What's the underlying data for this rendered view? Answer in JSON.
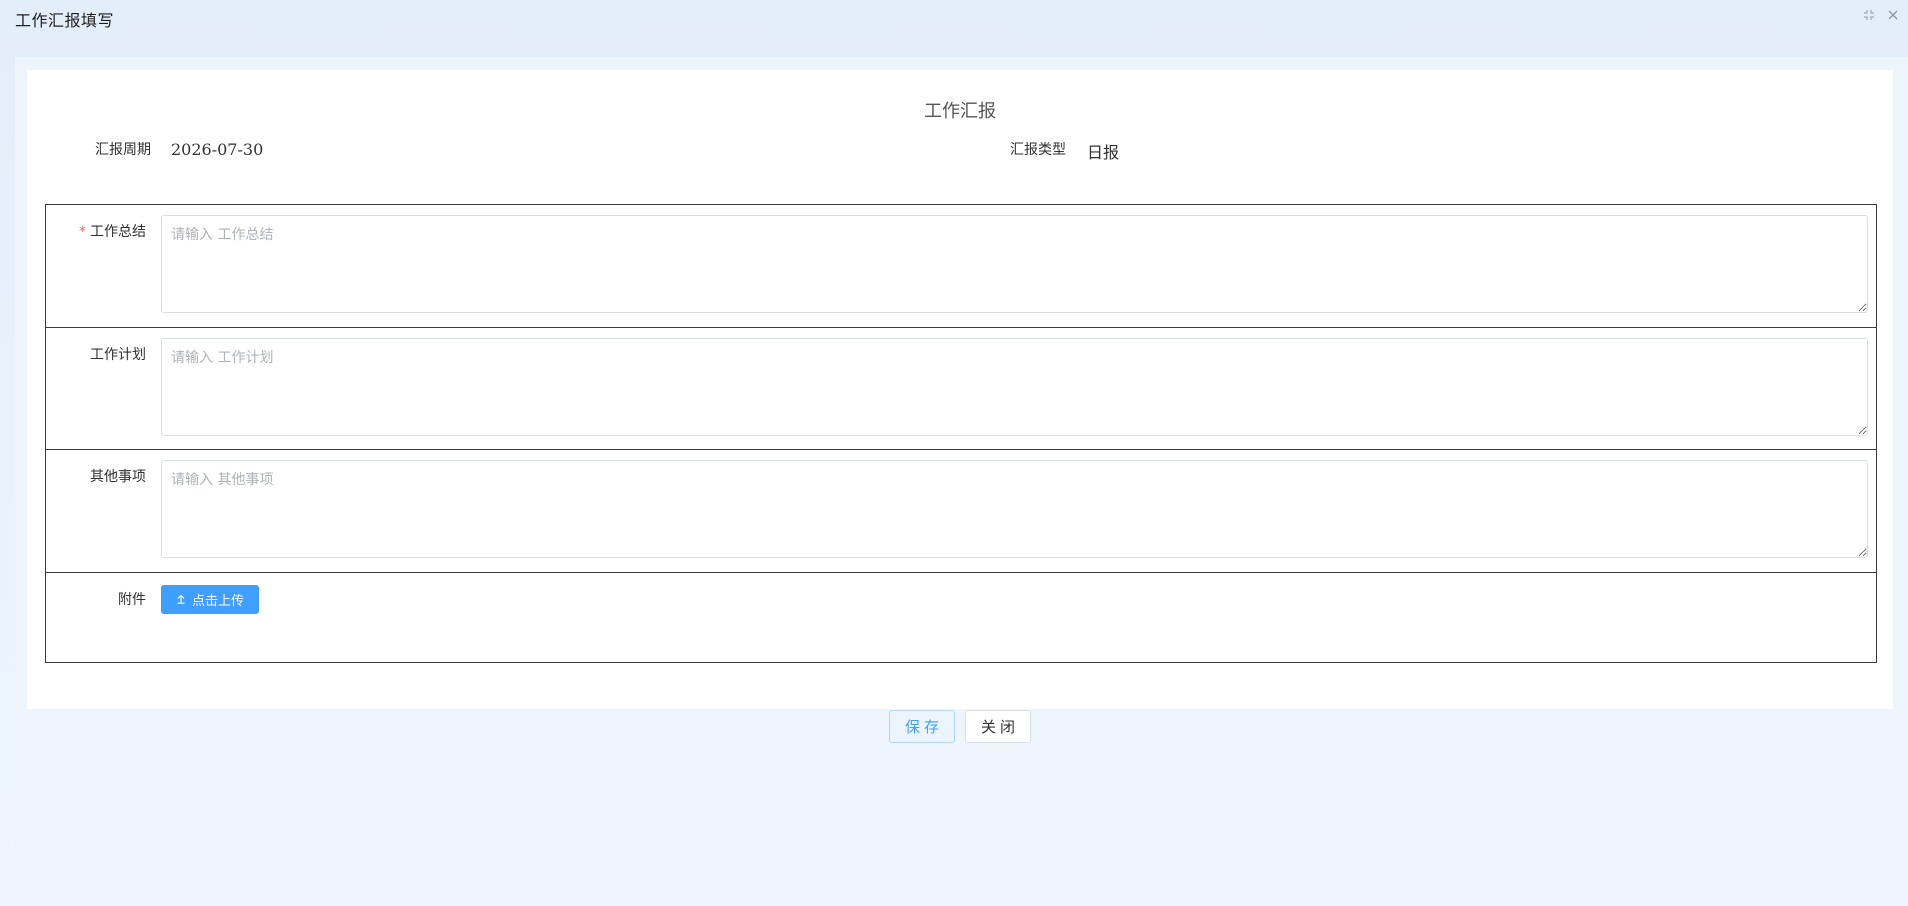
{
  "dialog": {
    "title": "工作汇报填写",
    "icons": [
      "compress-icon",
      "close-icon"
    ]
  },
  "form": {
    "title": "工作汇报",
    "period_label": "汇报周期",
    "period_value": "2026-07-30",
    "type_label": "汇报类型",
    "type_value": "日报",
    "fields": [
      {
        "label": "工作总结",
        "required": "*",
        "placeholder": "请输入 工作总结",
        "value": ""
      },
      {
        "label": "工作计划",
        "placeholder": "请输入 工作计划",
        "value": ""
      },
      {
        "label": "其他事项",
        "placeholder": "请输入 其他事项",
        "value": ""
      }
    ],
    "attachment_label": "附件",
    "upload_label": "点击上传"
  },
  "footer": {
    "save_label": "保存",
    "close_label": "关闭"
  },
  "colors": {
    "primary": "#409eff",
    "required": "#f56c6c",
    "table_border": "#3a3a3a"
  }
}
